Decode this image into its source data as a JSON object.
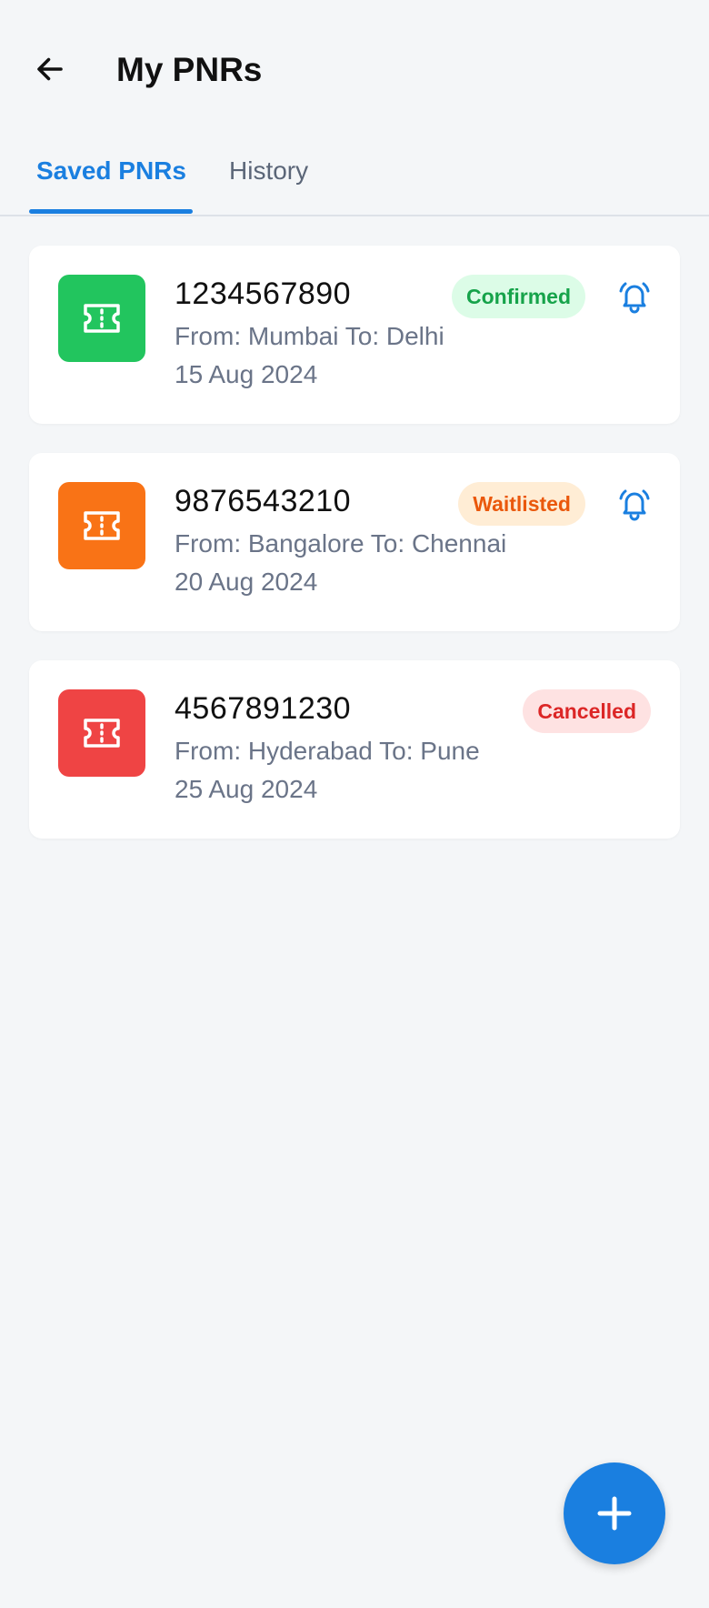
{
  "header": {
    "title": "My PNRs",
    "back_icon": "arrow-left-icon"
  },
  "tabs": [
    {
      "label": "Saved PNRs",
      "active": true
    },
    {
      "label": "History",
      "active": false
    }
  ],
  "pnrs": [
    {
      "number": "1234567890",
      "route": "From: Mumbai To: Delhi",
      "date": "15 Aug 2024",
      "status": "Confirmed",
      "icon_color": "#22c55e",
      "badge_bg": "#dcfce7",
      "badge_color": "#16a34a",
      "has_alert": true
    },
    {
      "number": "9876543210",
      "route": "From: Bangalore To: Chennai",
      "date": "20 Aug 2024",
      "status": "Waitlisted",
      "icon_color": "#f97316",
      "badge_bg": "#ffedd5",
      "badge_color": "#ea580c",
      "has_alert": true
    },
    {
      "number": "4567891230",
      "route": "From: Hyderabad To: Pune",
      "date": "25 Aug 2024",
      "status": "Cancelled",
      "icon_color": "#ef4444",
      "badge_bg": "#fee2e2",
      "badge_color": "#dc2626",
      "has_alert": false
    }
  ],
  "fab": {
    "icon": "plus-icon"
  },
  "colors": {
    "accent": "#1a7fe0",
    "background": "#f4f6f8"
  }
}
